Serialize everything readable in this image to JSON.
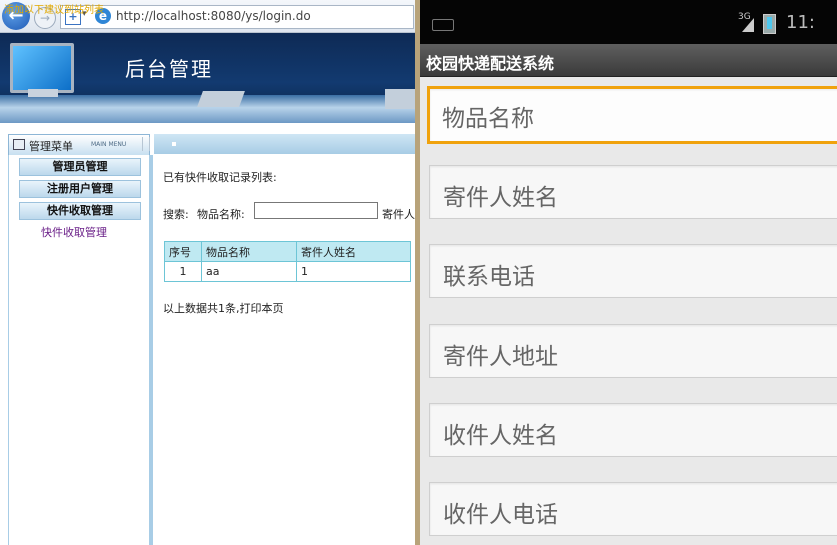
{
  "browser": {
    "url": "http://localhost:8080/ys/login.do",
    "favorites_label": "添加以下建议到站列表"
  },
  "admin": {
    "banner_title": "后台管理",
    "menu_title": "管理菜单",
    "menu_title_en": "MAIN MENU",
    "menu_items": [
      "管理员管理",
      "注册用户管理",
      "快件收取管理"
    ],
    "submenu_items": [
      "快件收取管理"
    ],
    "list_caption": "已有快件收取记录列表:",
    "search_label": "搜索:",
    "search_field_label": "物品名称:",
    "search_field_value": "",
    "search_field2_label": "寄件人",
    "table": {
      "headers": [
        "序号",
        "物品名称",
        "寄件人姓名"
      ],
      "rows": [
        [
          "1",
          "aa",
          "1"
        ]
      ]
    },
    "summary": "以上数据共1条,打印本页"
  },
  "android": {
    "network": "3G",
    "clock": "11:",
    "app_title": "校园快递配送系统",
    "fields": [
      {
        "hint": "物品名称",
        "focused": true
      },
      {
        "hint": "寄件人姓名",
        "focused": false
      },
      {
        "hint": "联系电话",
        "focused": false
      },
      {
        "hint": "寄件人地址",
        "focused": false
      },
      {
        "hint": "收件人姓名",
        "focused": false
      },
      {
        "hint": "收件人电话",
        "focused": false
      }
    ]
  },
  "colors": {
    "focus_border": "#f0a20d",
    "banner_bg": "#123a70",
    "table_border": "#6dc5d6",
    "submenu_text": "#6a1f88"
  }
}
